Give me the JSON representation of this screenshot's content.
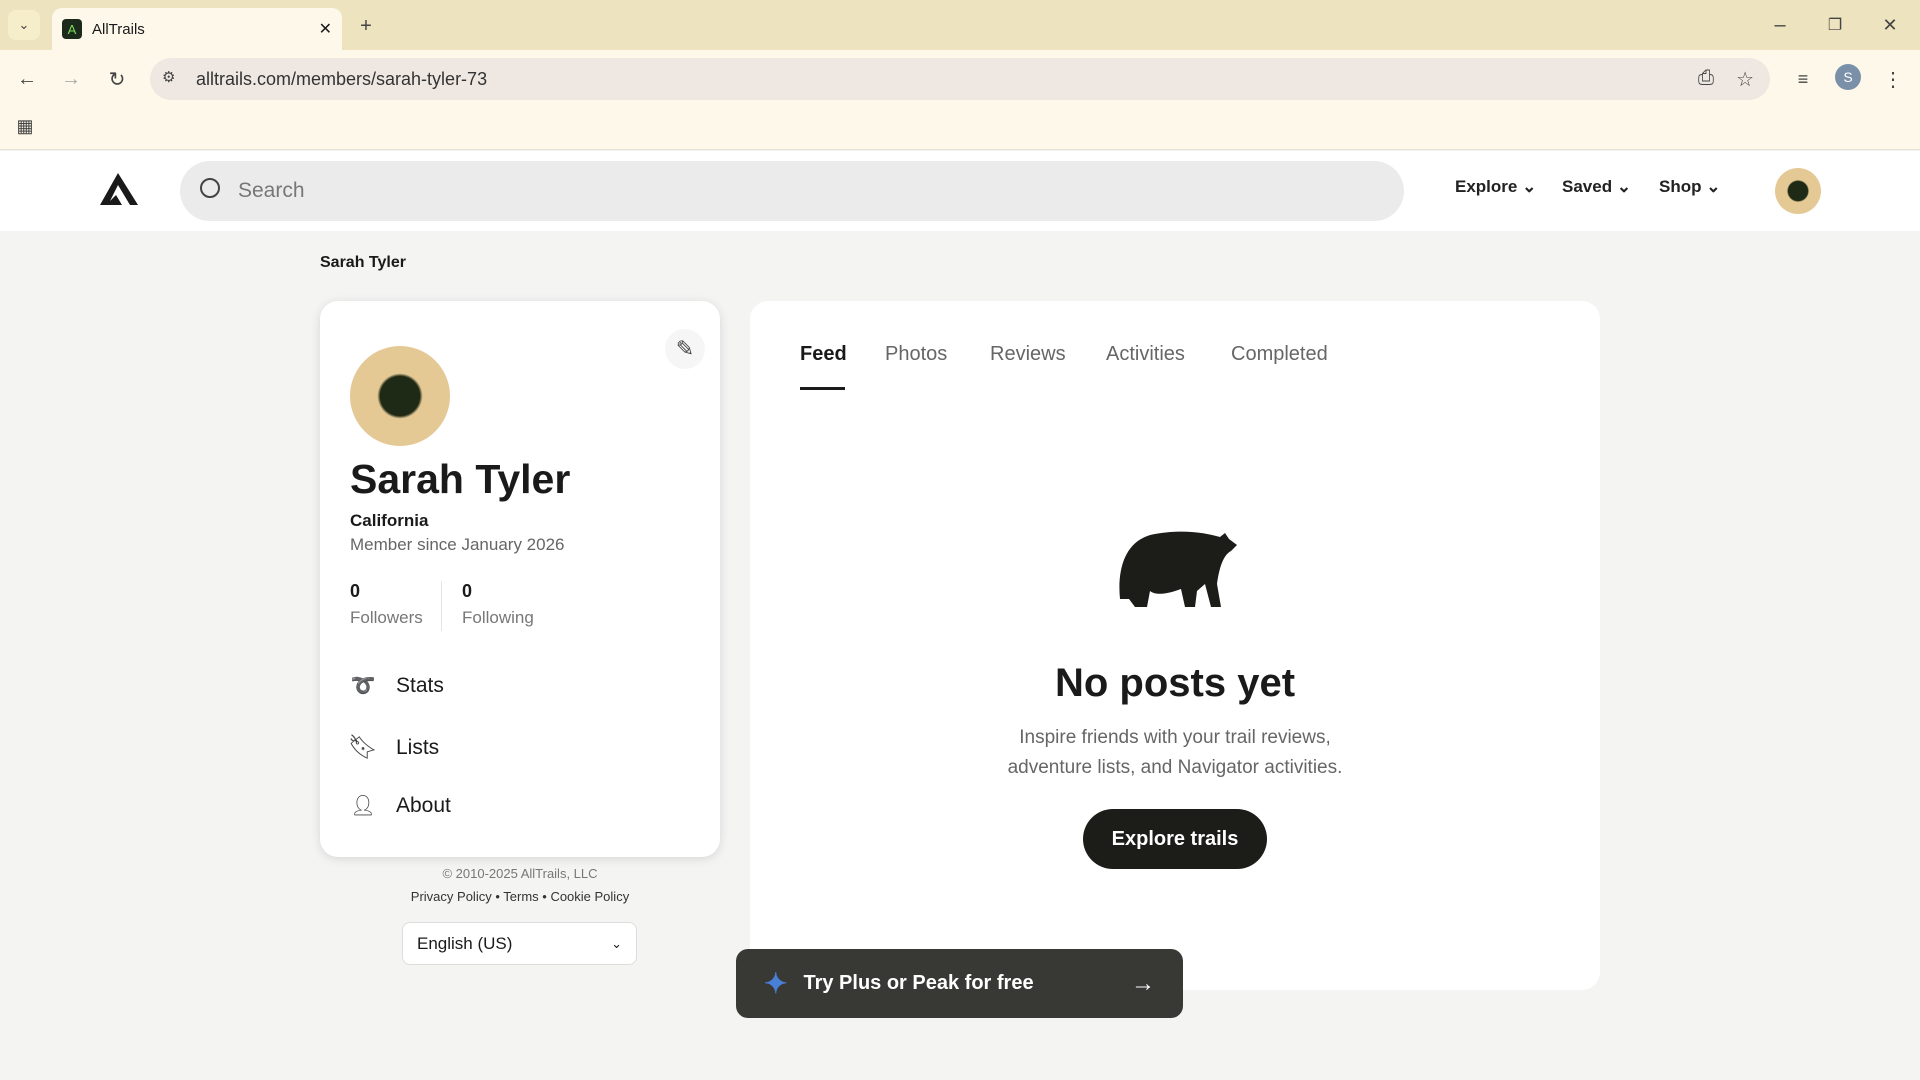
{
  "browser": {
    "tab_title": "AllTrails",
    "url": "alltrails.com/members/sarah-tyler-73",
    "profile_initial": "S"
  },
  "header": {
    "search_placeholder": "Search",
    "nav": [
      "Explore",
      "Saved",
      "Shop"
    ]
  },
  "breadcrumb": "Sarah Tyler",
  "profile": {
    "name": "Sarah Tyler",
    "location": "California",
    "member_since": "Member since January 2026",
    "followers_count": "0",
    "followers_label": "Followers",
    "following_count": "0",
    "following_label": "Following",
    "menu": [
      "Stats",
      "Lists",
      "About"
    ]
  },
  "footer": {
    "copyright": "© 2010-2025 AllTrails, LLC",
    "links": [
      "Privacy Policy",
      "Terms",
      "Cookie Policy"
    ],
    "language": "English (US)"
  },
  "feed": {
    "tabs": [
      "Feed",
      "Photos",
      "Reviews",
      "Activities",
      "Completed"
    ],
    "active_tab": "Feed",
    "empty_title": "No posts yet",
    "empty_line1": "Inspire friends with your trail reviews,",
    "empty_line2": "adventure lists, and Navigator activities.",
    "cta": "Explore trails"
  },
  "promo": {
    "label": "Try Plus or Peak for free",
    "accent": "#4a7fd6"
  }
}
